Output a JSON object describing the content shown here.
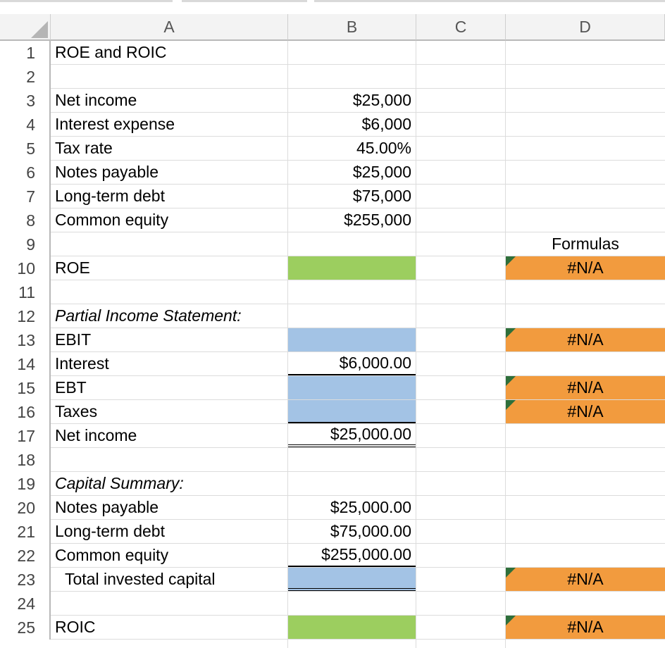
{
  "columns": [
    "A",
    "B",
    "C",
    "D"
  ],
  "rows": [
    "1",
    "2",
    "3",
    "4",
    "5",
    "6",
    "7",
    "8",
    "9",
    "10",
    "11",
    "12",
    "13",
    "14",
    "15",
    "16",
    "17",
    "18",
    "19",
    "20",
    "21",
    "22",
    "23",
    "24",
    "25"
  ],
  "sheet": {
    "title": "ROE and ROIC",
    "inputs": [
      {
        "label": "Net income",
        "value": "$25,000"
      },
      {
        "label": "Interest expense",
        "value": "$6,000"
      },
      {
        "label": "Tax rate",
        "value": "45.00%"
      },
      {
        "label": "Notes payable",
        "value": "$25,000"
      },
      {
        "label": "Long-term debt",
        "value": "$75,000"
      },
      {
        "label": "Common equity",
        "value": "$255,000"
      }
    ],
    "formulas_header": "Formulas",
    "roe": {
      "label": "ROE",
      "formula": "#N/A"
    },
    "income_statement": {
      "heading": "Partial Income Statement:",
      "ebit": {
        "label": "EBIT",
        "formula": "#N/A"
      },
      "interest": {
        "label": "Interest",
        "value": "$6,000.00"
      },
      "ebt": {
        "label": "EBT",
        "formula": "#N/A"
      },
      "taxes": {
        "label": "Taxes",
        "formula": "#N/A"
      },
      "net_income": {
        "label": "Net income",
        "value": "$25,000.00"
      }
    },
    "capital_summary": {
      "heading": "Capital Summary:",
      "notes_payable": {
        "label": "Notes payable",
        "value": "$25,000.00"
      },
      "long_term_debt": {
        "label": "Long-term debt",
        "value": "$75,000.00"
      },
      "common_equity": {
        "label": "Common equity",
        "value": "$255,000.00"
      },
      "total": {
        "label": "Total invested capital",
        "formula": "#N/A"
      }
    },
    "roic": {
      "label": "ROIC",
      "formula": "#N/A"
    }
  },
  "colors": {
    "input_fill": "#a3c3e5",
    "result_fill": "#9cce5f",
    "formula_fill": "#f29b3e",
    "error_indicator": "#2e6f3a"
  }
}
